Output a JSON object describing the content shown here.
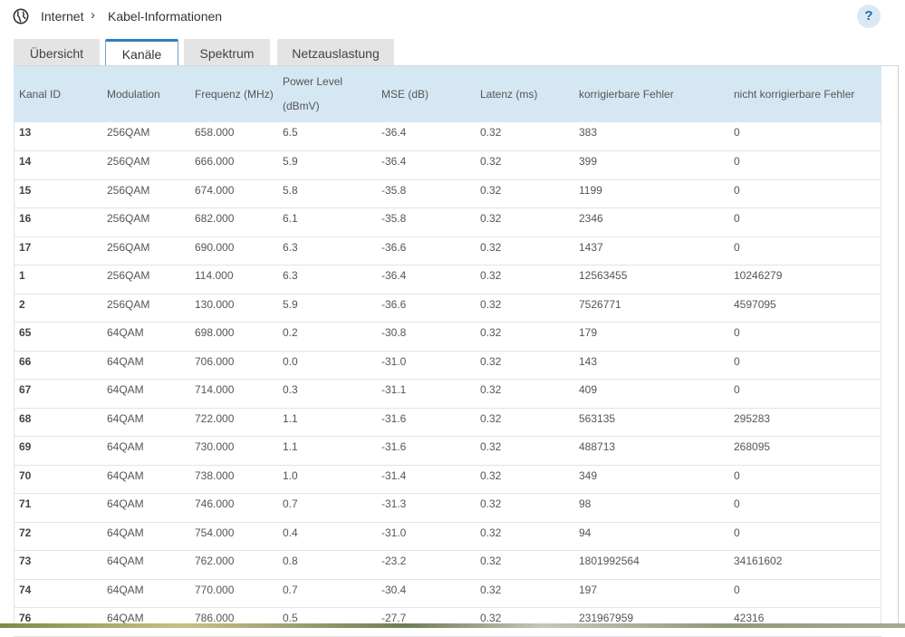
{
  "breadcrumb": {
    "section": "Internet",
    "separator": "›",
    "page": "Kabel-Informationen"
  },
  "help_label": "?",
  "tabs": [
    {
      "label": "Übersicht"
    },
    {
      "label": "Kanäle"
    },
    {
      "label": "Spektrum"
    },
    {
      "label": "Netzauslastung"
    }
  ],
  "table": {
    "headers": {
      "kanal_id": "Kanal ID",
      "modulation": "Modulation",
      "frequenz": "Frequenz (MHz)",
      "power_level": "Power Level",
      "power_unit": "(dBmV)",
      "mse": "MSE (dB)",
      "latenz": "Latenz (ms)",
      "korr": "korrigierbare Fehler",
      "nicht_korr": "nicht korrigierbare Fehler"
    },
    "rows": [
      [
        "13",
        "256QAM",
        "658.000",
        "6.5",
        "-36.4",
        "0.32",
        "383",
        "0"
      ],
      [
        "14",
        "256QAM",
        "666.000",
        "5.9",
        "-36.4",
        "0.32",
        "399",
        "0"
      ],
      [
        "15",
        "256QAM",
        "674.000",
        "5.8",
        "-35.8",
        "0.32",
        "1199",
        "0"
      ],
      [
        "16",
        "256QAM",
        "682.000",
        "6.1",
        "-35.8",
        "0.32",
        "2346",
        "0"
      ],
      [
        "17",
        "256QAM",
        "690.000",
        "6.3",
        "-36.6",
        "0.32",
        "1437",
        "0"
      ],
      [
        "1",
        "256QAM",
        "114.000",
        "6.3",
        "-36.4",
        "0.32",
        "12563455",
        "10246279"
      ],
      [
        "2",
        "256QAM",
        "130.000",
        "5.9",
        "-36.6",
        "0.32",
        "7526771",
        "4597095"
      ],
      [
        "65",
        "64QAM",
        "698.000",
        "0.2",
        "-30.8",
        "0.32",
        "179",
        "0"
      ],
      [
        "66",
        "64QAM",
        "706.000",
        "0.0",
        "-31.0",
        "0.32",
        "143",
        "0"
      ],
      [
        "67",
        "64QAM",
        "714.000",
        "0.3",
        "-31.1",
        "0.32",
        "409",
        "0"
      ],
      [
        "68",
        "64QAM",
        "722.000",
        "1.1",
        "-31.6",
        "0.32",
        "563135",
        "295283"
      ],
      [
        "69",
        "64QAM",
        "730.000",
        "1.1",
        "-31.6",
        "0.32",
        "488713",
        "268095"
      ],
      [
        "70",
        "64QAM",
        "738.000",
        "1.0",
        "-31.4",
        "0.32",
        "349",
        "0"
      ],
      [
        "71",
        "64QAM",
        "746.000",
        "0.7",
        "-31.3",
        "0.32",
        "98",
        "0"
      ],
      [
        "72",
        "64QAM",
        "754.000",
        "0.4",
        "-31.0",
        "0.32",
        "94",
        "0"
      ],
      [
        "73",
        "64QAM",
        "762.000",
        "0.8",
        "-23.2",
        "0.32",
        "1801992564",
        "34161602"
      ],
      [
        "74",
        "64QAM",
        "770.000",
        "0.7",
        "-30.4",
        "0.32",
        "197",
        "0"
      ],
      [
        "76",
        "64QAM",
        "786.000",
        "0.5",
        "-27.7",
        "0.32",
        "231967959",
        "42316"
      ]
    ]
  },
  "colors": {
    "accent": "#2f7dbd",
    "header_bg": "#d6e7f4",
    "tab_bg": "#e4e4e4"
  },
  "icons": {
    "globe": "globe-icon",
    "help": "help-icon",
    "separator": "chevron-right-icon"
  }
}
